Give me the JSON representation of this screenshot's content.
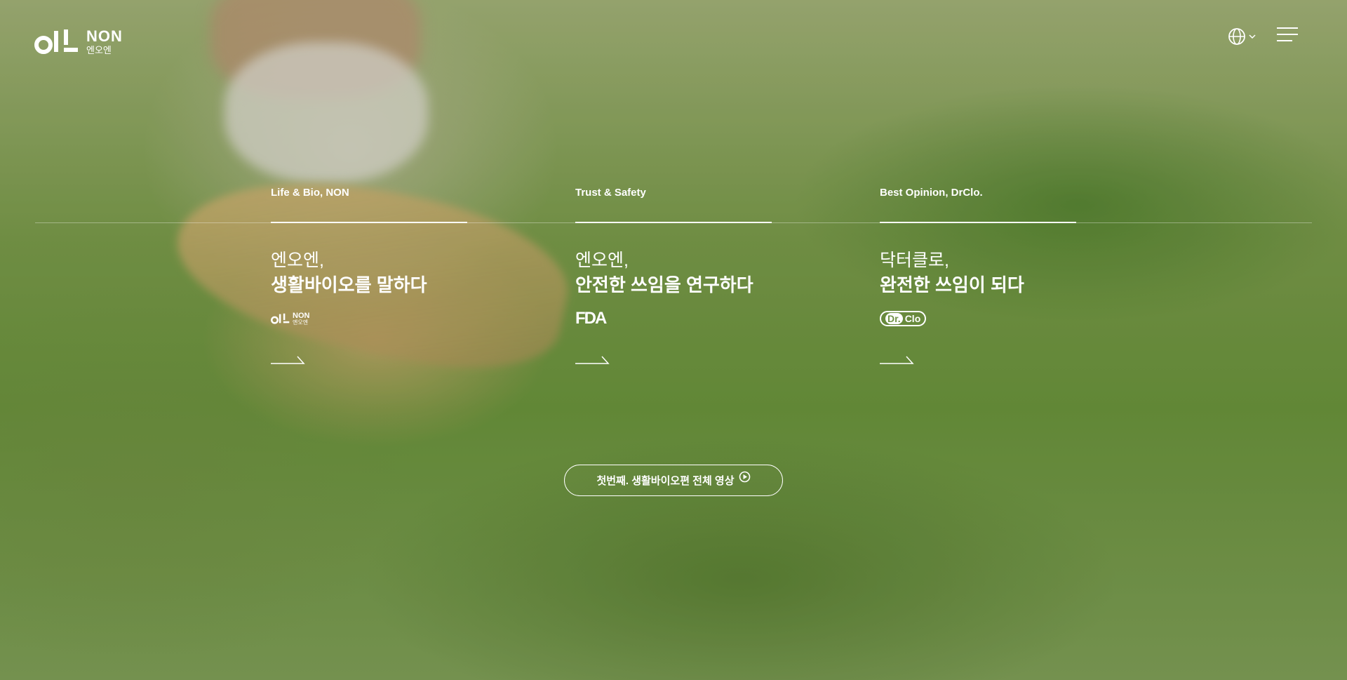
{
  "brand": {
    "name_en": "NON",
    "name_ko": "엔오엔"
  },
  "header": {
    "language_icon": "globe-icon",
    "dropdown_icon": "chevron-down-icon",
    "menu_icon": "hamburger-menu-icon"
  },
  "cards": [
    {
      "label": "Life & Bio, NON",
      "subtitle": "엔오엔,",
      "title": "생활바이오를 말하다",
      "brand_en": "NON",
      "brand_ko": "엔오엔"
    },
    {
      "label": "Trust & Safety",
      "subtitle": "엔오엔,",
      "title": "안전한 쓰임을 연구하다",
      "brand": "FDA"
    },
    {
      "label": "Best Opinion, DrClo.",
      "subtitle": "닥터클로,",
      "title": "완전한 쓰임이 되다",
      "brand_dr": "Dr.",
      "brand_clo": "Clo"
    }
  ],
  "video_button": {
    "label": "첫번째. 생활바이오편 전체 영상",
    "icon": "play-circle-icon"
  },
  "colors": {
    "text": "#ffffff",
    "background": "#6f9245"
  }
}
